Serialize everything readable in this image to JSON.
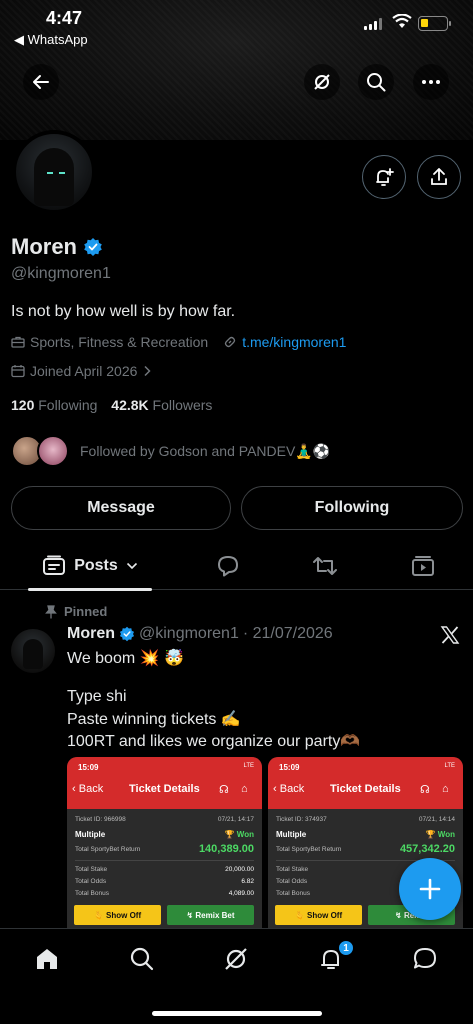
{
  "status_bar": {
    "time": "4:47",
    "back_app": "◀ WhatsApp"
  },
  "profile": {
    "name": "Moren",
    "handle": "@kingmoren1",
    "bio": "Is not by how well is by how far.",
    "category": "Sports, Fitness & Recreation",
    "link": "t.me/kingmoren1",
    "joined": "Joined April 2026",
    "following_count": "120",
    "following_label": "Following",
    "followers_count": "42.8K",
    "followers_label": "Followers",
    "followed_by": "Followed by Godson and PANDEV🧘‍♂️⚽"
  },
  "actions": {
    "message": "Message",
    "following": "Following"
  },
  "tabs": {
    "posts": "Posts"
  },
  "pinned_post": {
    "pinned_label": "Pinned",
    "author_name": "Moren",
    "author_handle": "@kingmoren1",
    "date": "· 21/07/2026",
    "lines": [
      "We boom 💥 🤯",
      "Type shi",
      "Paste winning tickets ✍️",
      "100RT and likes we organize our party🫶🏾"
    ]
  },
  "tickets": [
    {
      "time": "15:09",
      "status": "LTE",
      "back": "Back",
      "title": "Ticket Details",
      "ticket_id": "Ticket ID: 966998",
      "datetime": "07/21, 14:17",
      "type": "Multiple",
      "result": "🏆 Won",
      "return_label": "Total SportyBet Return",
      "return_value": "140,389.00",
      "stake_label": "Total Stake",
      "stake_value": "20,000.00",
      "odds_label": "Total Odds",
      "odds_value": "6.82",
      "bonus_label": "Total Bonus",
      "bonus_value": "4,089.00",
      "btn_show": "🫰 Show Off",
      "btn_remix": "↯ Remix Bet"
    },
    {
      "time": "15:09",
      "status": "LTE",
      "back": "Back",
      "title": "Ticket Details",
      "ticket_id": "Ticket ID: 374937",
      "datetime": "07/21, 14:14",
      "type": "Multiple",
      "result": "🏆 Won",
      "return_label": "Total SportyBet Return",
      "return_value": "457,342.20",
      "stake_label": "Total Stake",
      "stake_value": "",
      "odds_label": "Total Odds",
      "odds_value": "",
      "bonus_label": "Total Bonus",
      "bonus_value": "",
      "btn_show": "🫰 Show Off",
      "btn_remix": "↯ Remix"
    }
  ],
  "nav": {
    "notifications_badge": "1"
  },
  "colors": {
    "accent": "#1d9bf0",
    "background": "#000000",
    "muted_text": "#71767b",
    "ticket_red": "#d42b2b"
  }
}
